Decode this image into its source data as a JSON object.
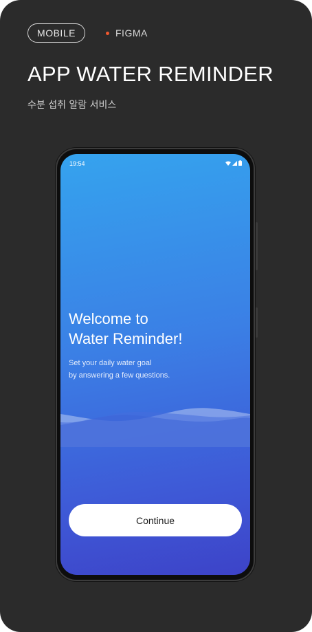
{
  "header": {
    "platform_tag": "MOBILE",
    "tool_label": "FIGMA",
    "title": "APP WATER REMINDER",
    "subtitle": "수분 섭취 알람 서비스"
  },
  "status_bar": {
    "time": "19:54",
    "icons": [
      "wifi-icon",
      "signal-icon",
      "battery-icon"
    ]
  },
  "onboarding": {
    "welcome_text": "Welcome to\nWater Reminder!",
    "description": "Set your daily water goal\nby answering a few questions.",
    "continue_label": "Continue"
  },
  "colors": {
    "card_background": "#2b2b2b",
    "accent_dot": "#f0582f",
    "screen_gradient_top": "#35a3ee",
    "screen_gradient_bottom": "#3d43c8",
    "button_background": "#ffffff"
  }
}
